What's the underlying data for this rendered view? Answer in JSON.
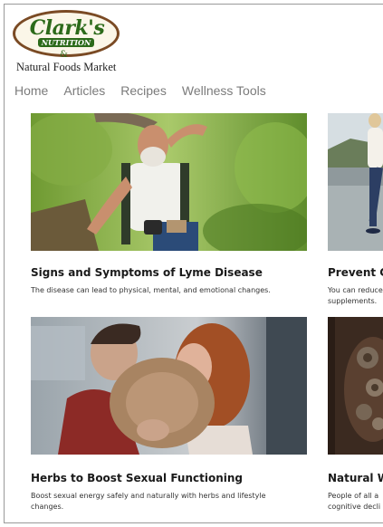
{
  "brand": {
    "logo_text": "Clark's",
    "logo_sub": "NUTRITION",
    "logo_amp": "&",
    "tagline": "Natural Foods Market"
  },
  "nav": {
    "items": [
      {
        "label": "Home"
      },
      {
        "label": "Articles"
      },
      {
        "label": "Recipes"
      },
      {
        "label": "Wellness Tools"
      }
    ]
  },
  "articles": [
    {
      "title": "Signs and Symptoms of Lyme Disease",
      "description": "The disease can lead to physical, mental, and emotional changes."
    },
    {
      "title": "Prevent Co",
      "description": "You can reduce supplements."
    },
    {
      "title": "Herbs to Boost Sexual Functioning",
      "description": "Boost sexual energy safely and naturally with herbs and lifestyle changes."
    },
    {
      "title": "Natural W",
      "description": "People of all a cognitive decli"
    }
  ],
  "colors": {
    "nav_text": "#7b7b7b",
    "logo_green": "#2c6a1a",
    "logo_brown": "#7a4a24",
    "title_text": "#1a1a1a"
  }
}
